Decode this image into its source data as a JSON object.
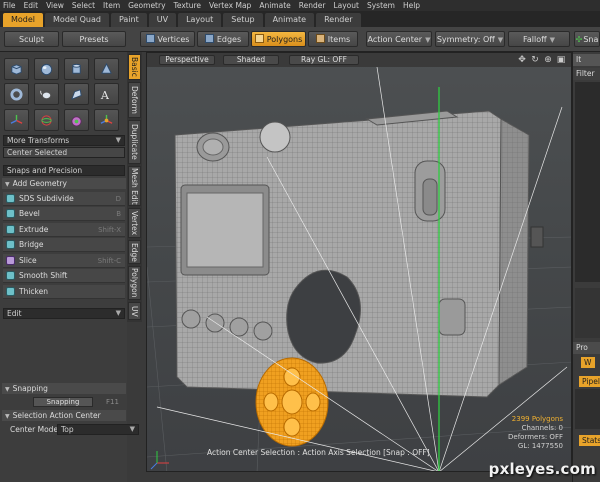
{
  "menu": [
    "File",
    "Edit",
    "View",
    "Select",
    "Item",
    "Geometry",
    "Texture",
    "Vertex Map",
    "Animate",
    "Render",
    "Layout",
    "System",
    "Help"
  ],
  "layout_tabs": [
    {
      "label": "Model",
      "active": true
    },
    {
      "label": "Model Quad",
      "active": false
    },
    {
      "label": "Paint",
      "active": false
    },
    {
      "label": "UV",
      "active": false
    },
    {
      "label": "Layout",
      "active": false
    },
    {
      "label": "Setup",
      "active": false
    },
    {
      "label": "Animate",
      "active": false
    },
    {
      "label": "Render",
      "active": false
    }
  ],
  "toolbar": {
    "sculpt": "Sculpt",
    "presets": "Presets",
    "vertices": "Vertices",
    "edges": "Edges",
    "polygons": "Polygons",
    "items": "Items",
    "action_center": "Action Center",
    "symmetry": "Symmetry: Off",
    "falloff": "Falloff",
    "snap": "Sna"
  },
  "left_panel": {
    "more_transforms": "More Transforms",
    "center_selected": "Center Selected",
    "snaps_precision": "Snaps and Precision",
    "add_geometry": "Add Geometry",
    "tools": [
      {
        "label": "SDS Subdivide",
        "key": "D"
      },
      {
        "label": "Bevel",
        "key": "B"
      },
      {
        "label": "Extrude",
        "key": "Shift-X"
      },
      {
        "label": "Bridge",
        "key": ""
      },
      {
        "label": "Slice",
        "key": "Shift-C"
      },
      {
        "label": "Smooth Shift",
        "key": ""
      },
      {
        "label": "Thicken",
        "key": ""
      }
    ],
    "edit": "Edit",
    "snapping_header": "Snapping",
    "snapping_button": "Snapping",
    "snapping_key": "F11",
    "selection_action_center": "Selection Action Center",
    "center_mode_label": "Center Mode",
    "center_mode_value": "Top"
  },
  "vertical_tabs": [
    {
      "label": "Basic",
      "active": true
    },
    {
      "label": "Deform",
      "active": false
    },
    {
      "label": "Duplicate",
      "active": false
    },
    {
      "label": "Mesh Edit",
      "active": false
    },
    {
      "label": "Vertex",
      "active": false
    },
    {
      "label": "Edge",
      "active": false
    },
    {
      "label": "Polygon",
      "active": false
    },
    {
      "label": "UV",
      "active": false
    }
  ],
  "viewport": {
    "perspective": "Perspective",
    "shaded": "Shaded",
    "ray_gl": "Ray GL: OFF",
    "status": "Action Center Selection : Action Axis Selection  [Snap : OFF]",
    "stats": {
      "polygons": "2399 Polygons",
      "channels": "Channels: 0",
      "deformers": "Deformers: OFF",
      "gl": "GL: 1477550"
    }
  },
  "right_panel": {
    "title": "It",
    "filter": "Filter",
    "properties": "Pro",
    "w_label": "W",
    "pipeline": "Pipeli",
    "stats": "Stats"
  },
  "watermark": "pxleyes.com",
  "colors": {
    "accent": "#e8a32a",
    "mesh_select": "#f0a020",
    "axis_green": "#2ecc40"
  }
}
